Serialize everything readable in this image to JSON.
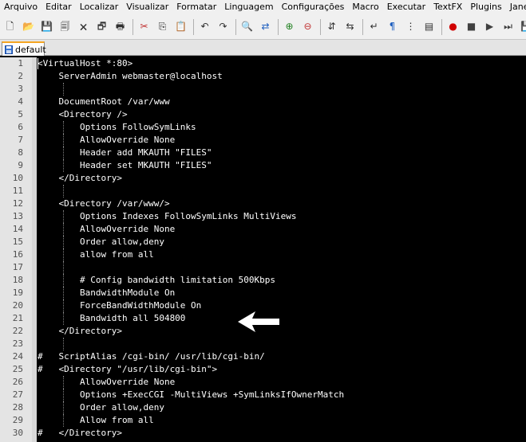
{
  "menubar": {
    "items": [
      "Arquivo",
      "Editar",
      "Localizar",
      "Visualizar",
      "Formatar",
      "Linguagem",
      "Configurações",
      "Macro",
      "Executar",
      "TextFX",
      "Plugins",
      "Janela",
      "?"
    ]
  },
  "toolbar": {
    "groups": [
      [
        "new-file-icon",
        "open-file-icon",
        "save-icon",
        "save-all-icon",
        "close-icon",
        "close-all-icon",
        "print-icon"
      ],
      [
        "cut-icon",
        "copy-icon",
        "paste-icon"
      ],
      [
        "undo-icon",
        "redo-icon"
      ],
      [
        "find-icon",
        "replace-icon"
      ],
      [
        "zoom-in-icon",
        "zoom-out-icon"
      ],
      [
        "sync-vertical-icon",
        "sync-horizontal-icon"
      ],
      [
        "word-wrap-icon",
        "show-all-chars-icon",
        "indent-guide-icon",
        "doc-map-icon"
      ],
      [
        "record-macro-icon",
        "stop-record-icon",
        "play-macro-icon",
        "run-macro-multiple-icon",
        "save-macro-icon"
      ]
    ],
    "glyphs": {
      "new-file-icon": "🗋",
      "open-file-icon": "📂",
      "save-icon": "💾",
      "save-all-icon": "🗐",
      "close-icon": "🗙",
      "close-all-icon": "🗗",
      "print-icon": "🖶",
      "cut-icon": "✂",
      "copy-icon": "⎘",
      "paste-icon": "📋",
      "undo-icon": "↶",
      "redo-icon": "↷",
      "find-icon": "🔍",
      "replace-icon": "⇄",
      "zoom-in-icon": "⊕",
      "zoom-out-icon": "⊖",
      "sync-vertical-icon": "⇵",
      "sync-horizontal-icon": "⇆",
      "word-wrap-icon": "↵",
      "show-all-chars-icon": "¶",
      "indent-guide-icon": "⋮",
      "doc-map-icon": "▤",
      "record-macro-icon": "●",
      "stop-record-icon": "■",
      "play-macro-icon": "▶",
      "run-macro-multiple-icon": "⏭",
      "save-macro-icon": "💾"
    },
    "colors": {
      "record-macro-icon": "#d00000",
      "stop-record-icon": "#404040",
      "play-macro-icon": "#404040",
      "run-macro-multiple-icon": "#404040",
      "save-macro-icon": "#2060c0",
      "cut-icon": "#c03030",
      "find-icon": "#404040",
      "replace-icon": "#2060c0",
      "zoom-in-icon": "#208020",
      "zoom-out-icon": "#c03030",
      "show-all-chars-icon": "#2060c0"
    }
  },
  "tabs": [
    {
      "label": "default",
      "active": true
    }
  ],
  "editor": {
    "colors": {
      "background": "#000000",
      "text": "#ffffff",
      "gutter": "#e4e4e4",
      "line_number": "#505050"
    },
    "lines": [
      {
        "n": "1",
        "text": "<VirtualHost *:80>",
        "guides": []
      },
      {
        "n": "2",
        "text": "    ServerAdmin webmaster@localhost",
        "guides": []
      },
      {
        "n": "3",
        "text": "",
        "guides": [
          4
        ]
      },
      {
        "n": "4",
        "text": "    DocumentRoot /var/www",
        "guides": []
      },
      {
        "n": "5",
        "text": "    <Directory />",
        "guides": []
      },
      {
        "n": "6",
        "text": "        Options FollowSymLinks",
        "guides": [
          4
        ]
      },
      {
        "n": "7",
        "text": "        AllowOverride None",
        "guides": [
          4
        ]
      },
      {
        "n": "8",
        "text": "        Header add MKAUTH \"FILES\"",
        "guides": [
          4
        ]
      },
      {
        "n": "9",
        "text": "        Header set MKAUTH \"FILES\"",
        "guides": [
          4
        ]
      },
      {
        "n": "10",
        "text": "    </Directory>",
        "guides": []
      },
      {
        "n": "11",
        "text": "",
        "guides": [
          4
        ]
      },
      {
        "n": "12",
        "text": "    <Directory /var/www/>",
        "guides": []
      },
      {
        "n": "13",
        "text": "        Options Indexes FollowSymLinks MultiViews",
        "guides": [
          4
        ]
      },
      {
        "n": "14",
        "text": "        AllowOverride None",
        "guides": [
          4
        ]
      },
      {
        "n": "15",
        "text": "        Order allow,deny",
        "guides": [
          4
        ]
      },
      {
        "n": "16",
        "text": "        allow from all",
        "guides": [
          4
        ]
      },
      {
        "n": "17",
        "text": "",
        "guides": [
          4
        ]
      },
      {
        "n": "18",
        "text": "        # Config bandwidth limitation 500Kbps",
        "guides": [
          4
        ]
      },
      {
        "n": "19",
        "text": "        BandwidthModule On",
        "guides": [
          4
        ]
      },
      {
        "n": "20",
        "text": "        ForceBandWidthModule On",
        "guides": [
          4
        ]
      },
      {
        "n": "21",
        "text": "        Bandwidth all 504800",
        "guides": [
          4
        ]
      },
      {
        "n": "22",
        "text": "    </Directory>",
        "guides": []
      },
      {
        "n": "23",
        "text": "",
        "guides": [
          4
        ]
      },
      {
        "n": "24",
        "text": "#   ScriptAlias /cgi-bin/ /usr/lib/cgi-bin/",
        "guides": []
      },
      {
        "n": "25",
        "text": "#   <Directory \"/usr/lib/cgi-bin\">",
        "guides": []
      },
      {
        "n": "26",
        "text": "        AllowOverride None",
        "guides": [
          4
        ]
      },
      {
        "n": "27",
        "text": "        Options +ExecCGI -MultiViews +SymLinksIfOwnerMatch",
        "guides": [
          4
        ]
      },
      {
        "n": "28",
        "text": "        Order allow,deny",
        "guides": [
          4
        ]
      },
      {
        "n": "29",
        "text": "        Allow from all",
        "guides": [
          4
        ]
      },
      {
        "n": "30",
        "text": "#   </Directory>",
        "guides": []
      }
    ]
  }
}
